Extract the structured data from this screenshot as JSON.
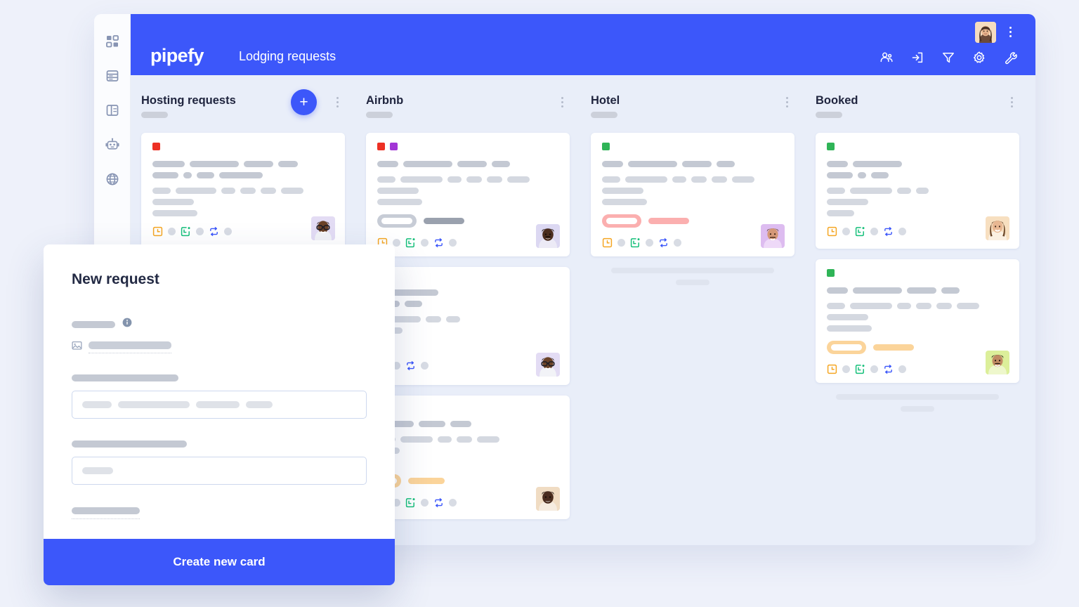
{
  "app": {
    "brand": "pipefy",
    "board_title": "Lodging requests",
    "accent_blue": "#3c57fa",
    "page_bg": "#eef1fa",
    "board_bg": "#e9eef9"
  },
  "rail": {
    "items": [
      {
        "name": "dashboard-icon",
        "label": "Dashboard"
      },
      {
        "name": "database-icon",
        "label": "Database"
      },
      {
        "name": "board-layout-icon",
        "label": "Board"
      },
      {
        "name": "robot-icon",
        "label": "Automations"
      },
      {
        "name": "globe-icon",
        "label": "Public form"
      }
    ]
  },
  "topbar": {
    "icons": [
      {
        "name": "members-icon",
        "label": "Members"
      },
      {
        "name": "import-icon",
        "label": "Import"
      },
      {
        "name": "filter-icon",
        "label": "Filter"
      },
      {
        "name": "gear-icon",
        "label": "Settings"
      },
      {
        "name": "wrench-icon",
        "label": "Tools"
      }
    ],
    "avatar_alt": "User avatar",
    "kebab_label": "More options"
  },
  "columns": [
    {
      "title": "Hosting requests",
      "add_label": "+",
      "kebab_label": "Phase options",
      "cards": [
        {
          "labels": [
            "#ed3024"
          ],
          "badge": null,
          "avatar_tone": "#e8d7c4",
          "avatar_skin": "#6b4328",
          "foot_icons": [
            "clock-icon",
            "calendar-icon",
            "sync-icon"
          ]
        }
      ],
      "ghost": false
    },
    {
      "title": "Airbnb",
      "kebab_label": "Phase options",
      "cards": [
        {
          "labels": [
            "#ed3024",
            "#a236d6"
          ],
          "badge": {
            "pill": "#c7ccd6",
            "bar": "#9aa1ae"
          },
          "avatar_tone": "#d9d2ee",
          "avatar_skin": "#4a2c1e",
          "foot_icons": [
            "clock-icon",
            "calendar-icon",
            "sync-icon"
          ]
        },
        {
          "labels": [],
          "badge": null,
          "avatar_tone": "#e0ddf4",
          "avatar_skin": "#6b4328",
          "foot_icons": [
            "calendar-icon",
            "sync-icon"
          ]
        },
        {
          "labels": [],
          "badge": {
            "pill": "#fbd49a",
            "bar": "#fbd49a"
          },
          "avatar_tone": "#efd9c2",
          "avatar_skin": "#4a2c1e",
          "foot_icons": [
            "clock-icon",
            "calendar-icon",
            "sync-icon"
          ]
        }
      ],
      "ghost": false
    },
    {
      "title": "Hotel",
      "kebab_label": "Phase options",
      "cards": [
        {
          "labels": [
            "#2fb457"
          ],
          "badge": {
            "pill": "#fbafaf",
            "bar": "#fbafaf"
          },
          "avatar_tone": "#ddbcf0",
          "avatar_skin": "#c98e6e",
          "foot_icons": [
            "clock-icon",
            "calendar-icon",
            "sync-icon"
          ]
        }
      ],
      "ghost": true
    },
    {
      "title": "Booked",
      "kebab_label": "Phase options",
      "cards": [
        {
          "labels": [
            "#2fb457"
          ],
          "badge": null,
          "avatar_tone": "#f4dcc0",
          "avatar_skin": "#d3a183",
          "foot_icons": [
            "clock-icon",
            "calendar-icon",
            "sync-icon"
          ]
        },
        {
          "labels": [
            "#2fb457"
          ],
          "badge": {
            "pill": "#fbd49a",
            "bar": "#fbd49a"
          },
          "avatar_tone": "#dcef9a",
          "avatar_skin": "#8b5a38",
          "foot_icons": [
            "clock-icon",
            "calendar-icon",
            "sync-icon"
          ]
        }
      ],
      "ghost": true
    }
  ],
  "modal": {
    "title": "New request",
    "submit_label": "Create new card",
    "info_icon": "info-icon",
    "media_icon": "image-field-icon"
  }
}
